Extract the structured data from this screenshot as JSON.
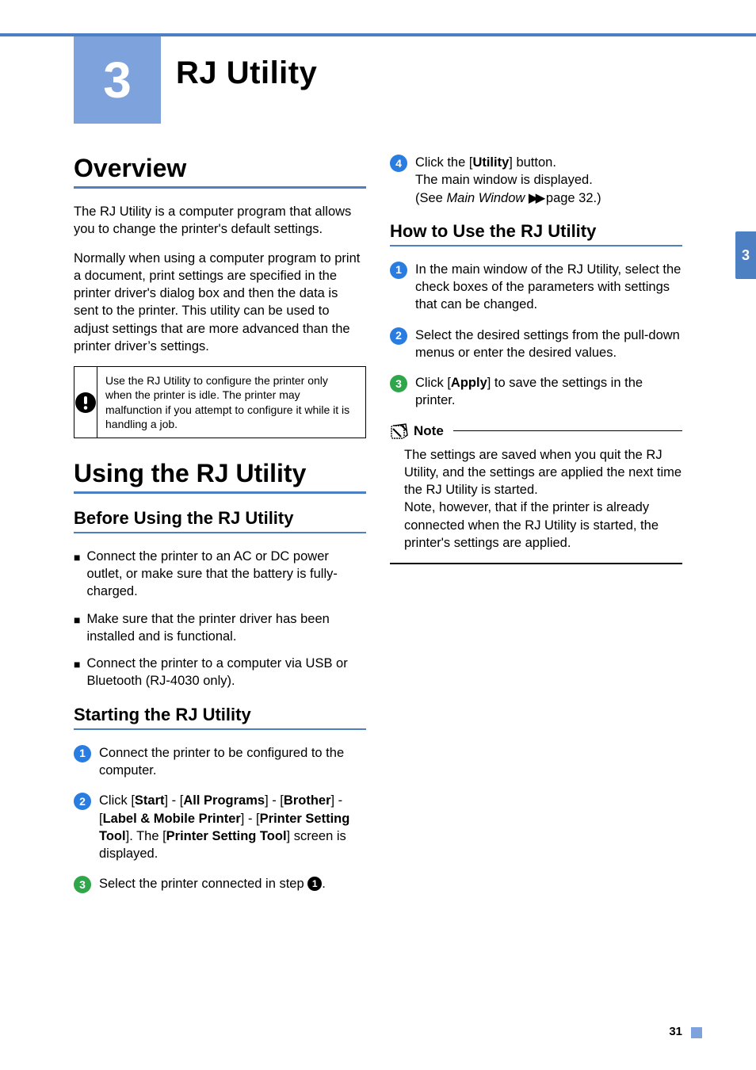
{
  "chapter": {
    "number": "3",
    "title": "RJ Utility"
  },
  "side_tab": "3",
  "left": {
    "overview_heading": "Overview",
    "overview_p1": "The RJ Utility is a computer program that allows you to change the printer's default settings.",
    "overview_p2": "Normally when using a computer program to print a document, print settings are specified in the printer driver's dialog box and then the data is sent to the printer. This utility can be used to adjust settings that are more advanced than the printer driver’s settings.",
    "caution_text": "Use the RJ Utility to configure the printer only when the printer is idle. The printer may malfunction if you attempt to configure it while it is handling a job.",
    "using_heading": "Using the RJ Utility",
    "before_heading": "Before Using the RJ Utility",
    "bullets": [
      "Connect the printer to an AC or DC power outlet, or make sure that the battery is fully-charged.",
      "Make sure that the printer driver has been installed and is functional.",
      "Connect the printer to a computer via USB or Bluetooth (RJ-4030 only)."
    ],
    "starting_heading": "Starting the RJ Utility",
    "steps": {
      "s1": "Connect the printer to be configured to the computer.",
      "s2_pre": "Click [",
      "s2_start": "Start",
      "s2_a": "] - [",
      "s2_allprograms": "All Programs",
      "s2_b": "] - [",
      "s2_brother": "Brother",
      "s2_c": "] - [",
      "s2_label": "Label & Mobile Printer",
      "s2_d": "] - [",
      "s2_pst": "Printer Setting Tool",
      "s2_e": "]. The [",
      "s2_pst2": "Printer Setting Tool",
      "s2_f": "] screen is displayed.",
      "s3_pre": "Select the printer connected in step ",
      "s3_ref": "1",
      "s3_post": "."
    }
  },
  "right": {
    "s4_pre": "Click the [",
    "s4_utility": "Utility",
    "s4_post1": "] button.",
    "s4_line2": "The main window is displayed.",
    "s4_see_pre": "(See ",
    "s4_see_italic": "Main Window",
    "s4_see_arrows": "▶▶",
    "s4_see_post": " page 32.)",
    "howto_heading": "How to Use the RJ Utility",
    "h1": "In the main window of the RJ Utility, select the check boxes of the parameters with settings that can be changed.",
    "h2": "Select the desired settings from the pull-down menus or enter the desired values.",
    "h3_pre": "Click [",
    "h3_apply": "Apply",
    "h3_post": "] to save the settings in the printer.",
    "note_label": "Note",
    "note_body": "The settings are saved when you quit the RJ Utility, and the settings are applied the next time the RJ Utility is started.\nNote, however, that if the printer is already connected when the RJ Utility is started, the printer's settings are applied."
  },
  "page_number": "31"
}
